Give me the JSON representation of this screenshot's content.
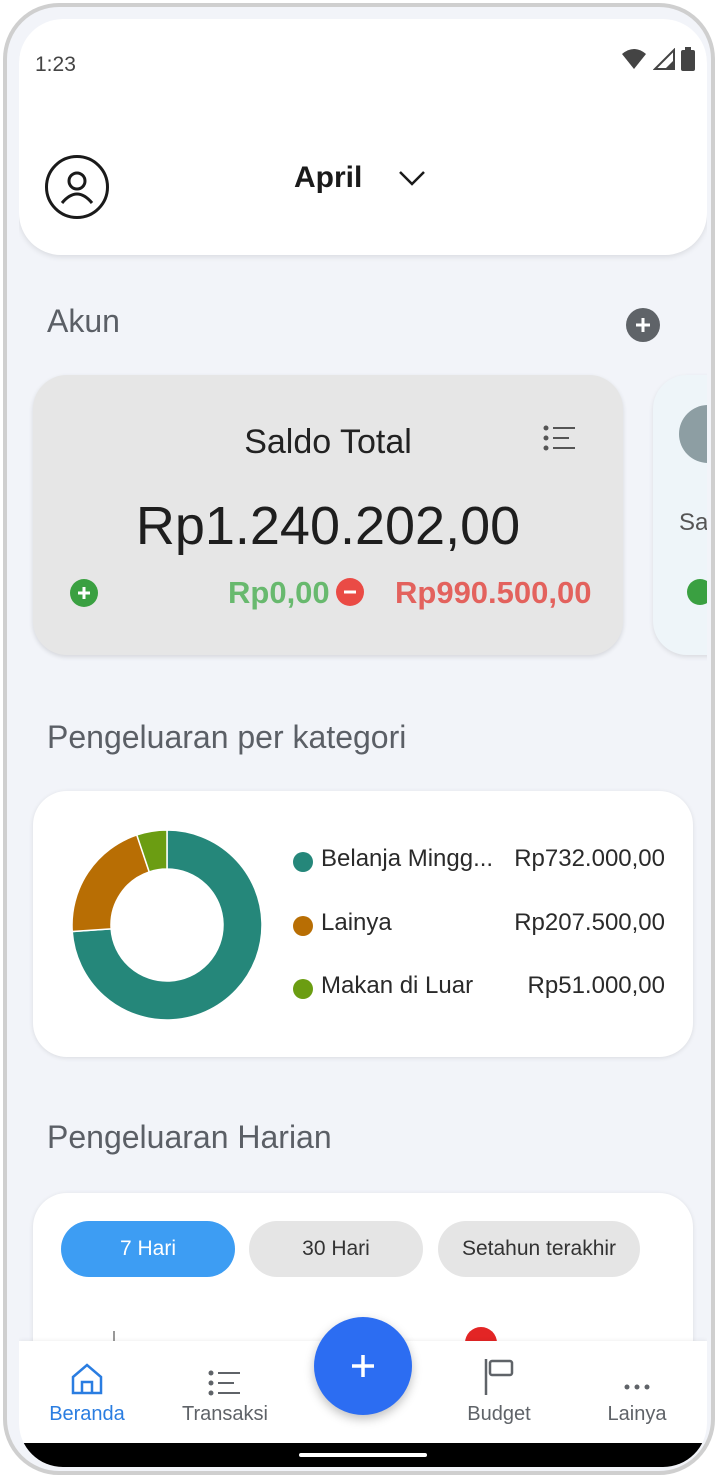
{
  "status_bar": {
    "time": "1:23",
    "icons": [
      "wifi-icon",
      "signal-icon",
      "battery-icon"
    ]
  },
  "header": {
    "month": "April",
    "avatar_icon": "user-icon",
    "dropdown_icon": "chevron-down-icon"
  },
  "accounts": {
    "title": "Akun",
    "add_icon": "plus-circle-icon",
    "total_card": {
      "title": "Saldo Total",
      "balance": "Rp1.240.202,00",
      "income": "Rp0,00",
      "expense": "Rp990.500,00",
      "list_icon": "list-icon"
    },
    "peek_card": {
      "label": "Sa"
    }
  },
  "categories": {
    "title": "Pengeluaran per kategori",
    "items": [
      {
        "name": "Belanja Mingg...",
        "amount": "Rp732.000,00",
        "value": 732000,
        "color": "#25877a"
      },
      {
        "name": "Lainya",
        "amount": "Rp207.500,00",
        "value": 207500,
        "color": "#b86e04"
      },
      {
        "name": "Makan di Luar",
        "amount": "Rp51.000,00",
        "value": 51000,
        "color": "#6b9d12"
      }
    ]
  },
  "daily": {
    "title": "Pengeluaran Harian",
    "ranges": [
      {
        "label": "7 Hari",
        "active": true
      },
      {
        "label": "30 Hari",
        "active": false
      },
      {
        "label": "Setahun terakhir",
        "active": false
      }
    ]
  },
  "bottom_nav": {
    "items": [
      {
        "label": "Beranda",
        "icon": "home-icon",
        "active": true
      },
      {
        "label": "Transaksi",
        "icon": "list-icon",
        "active": false
      },
      {
        "label": "Budget",
        "icon": "flag-icon",
        "active": false
      },
      {
        "label": "Lainya",
        "icon": "more-icon",
        "active": false
      }
    ],
    "fab_icon": "plus-icon"
  },
  "colors": {
    "accent": "#2c6df2",
    "income": "#68b96e",
    "expense": "#e3625d",
    "chip_active": "#3d9df3"
  }
}
